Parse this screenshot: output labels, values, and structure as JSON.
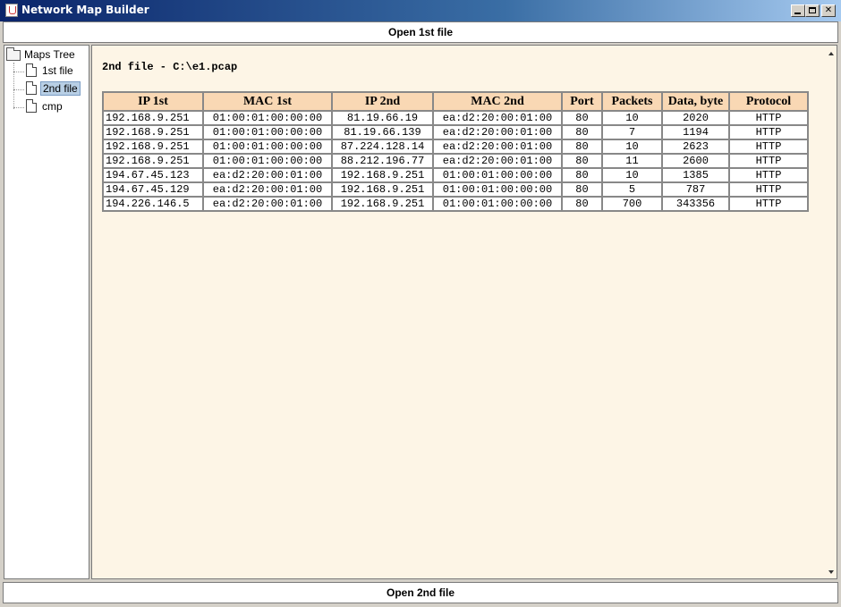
{
  "window": {
    "title": "Network Map Builder"
  },
  "buttons": {
    "open_first": "Open 1st file",
    "open_second": "Open 2nd file"
  },
  "tree": {
    "root": "Maps Tree",
    "items": [
      {
        "label": "1st file",
        "selected": false
      },
      {
        "label": "2nd file",
        "selected": true
      },
      {
        "label": "cmp",
        "selected": false
      }
    ]
  },
  "content": {
    "file_title": "2nd file - C:\\e1.pcap",
    "table": {
      "headers": [
        "IP 1st",
        "MAC 1st",
        "IP 2nd",
        "MAC 2nd",
        "Port",
        "Packets",
        "Data, byte",
        "Protocol"
      ],
      "rows": [
        [
          "192.168.9.251",
          "01:00:01:00:00:00",
          "81.19.66.19",
          "ea:d2:20:00:01:00",
          "80",
          "10",
          "2020",
          "HTTP"
        ],
        [
          "192.168.9.251",
          "01:00:01:00:00:00",
          "81.19.66.139",
          "ea:d2:20:00:01:00",
          "80",
          "7",
          "1194",
          "HTTP"
        ],
        [
          "192.168.9.251",
          "01:00:01:00:00:00",
          "87.224.128.14",
          "ea:d2:20:00:01:00",
          "80",
          "10",
          "2623",
          "HTTP"
        ],
        [
          "192.168.9.251",
          "01:00:01:00:00:00",
          "88.212.196.77",
          "ea:d2:20:00:01:00",
          "80",
          "11",
          "2600",
          "HTTP"
        ],
        [
          "194.67.45.123",
          "ea:d2:20:00:01:00",
          "192.168.9.251",
          "01:00:01:00:00:00",
          "80",
          "10",
          "1385",
          "HTTP"
        ],
        [
          "194.67.45.129",
          "ea:d2:20:00:01:00",
          "192.168.9.251",
          "01:00:01:00:00:00",
          "80",
          "5",
          "787",
          "HTTP"
        ],
        [
          "194.226.146.5",
          "ea:d2:20:00:01:00",
          "192.168.9.251",
          "01:00:01:00:00:00",
          "80",
          "700",
          "343356",
          "HTTP"
        ]
      ]
    }
  },
  "colors": {
    "content_bg": "#fdf5e6",
    "header_bg": "#f9d8b4",
    "selection_bg": "#b8cfe5"
  }
}
